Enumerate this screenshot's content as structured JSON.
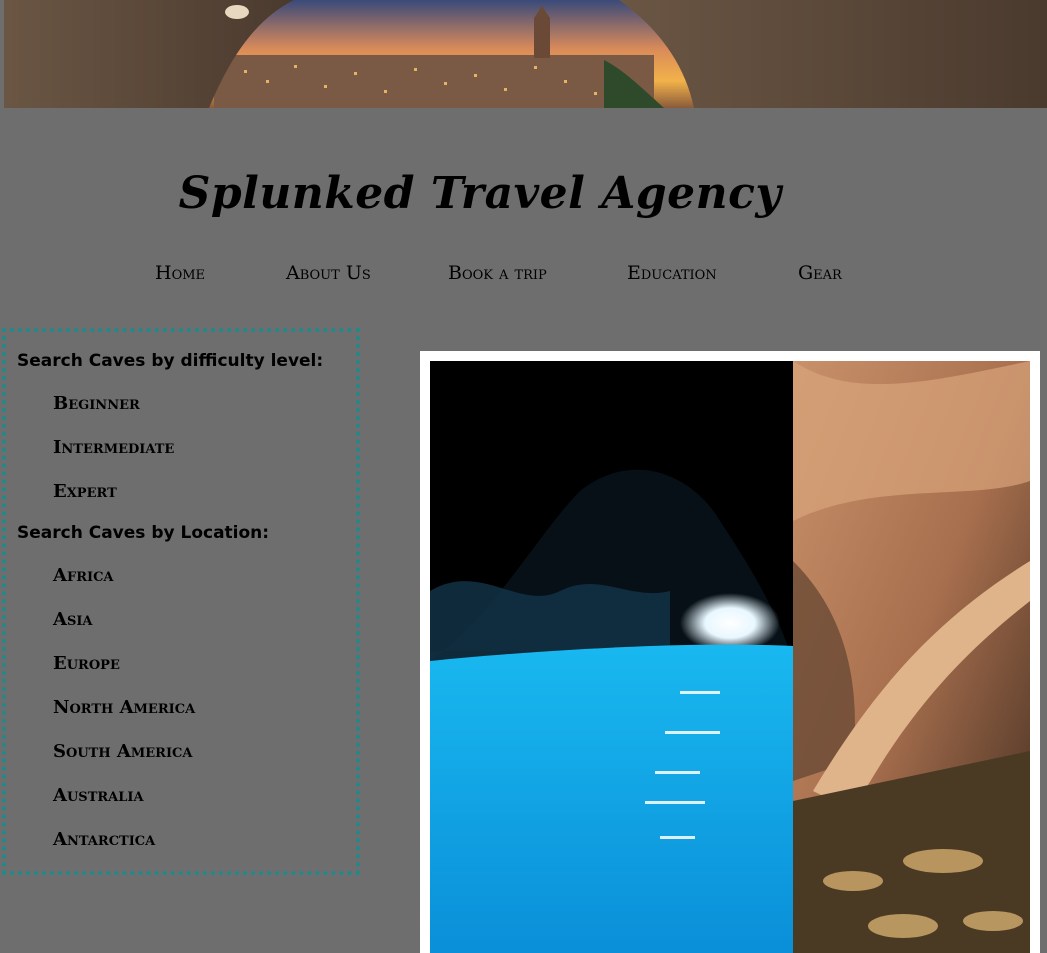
{
  "banner": {
    "alt": "Matera cave view banner"
  },
  "site": {
    "title": "Splunked Travel Agency"
  },
  "nav": {
    "items": [
      {
        "label": "Home"
      },
      {
        "label": "About Us"
      },
      {
        "label": "Book a trip"
      },
      {
        "label": "Education"
      },
      {
        "label": "Gear"
      }
    ]
  },
  "sidebar": {
    "difficulty_heading": "Search Caves by difficulty level:",
    "difficulty": [
      {
        "label": "Beginner"
      },
      {
        "label": "Intermediate"
      },
      {
        "label": "Expert"
      }
    ],
    "location_heading": "Search Caves by Location:",
    "locations": [
      {
        "label": "Africa"
      },
      {
        "label": "Asia"
      },
      {
        "label": "Europe"
      },
      {
        "label": "North America"
      },
      {
        "label": "South America"
      },
      {
        "label": "Australia"
      },
      {
        "label": "Antarctica"
      }
    ]
  },
  "colors": {
    "page_bg": "#6e6e6e",
    "sidebar_border": "#1e8b8b",
    "photo_frame": "#ffffff"
  }
}
